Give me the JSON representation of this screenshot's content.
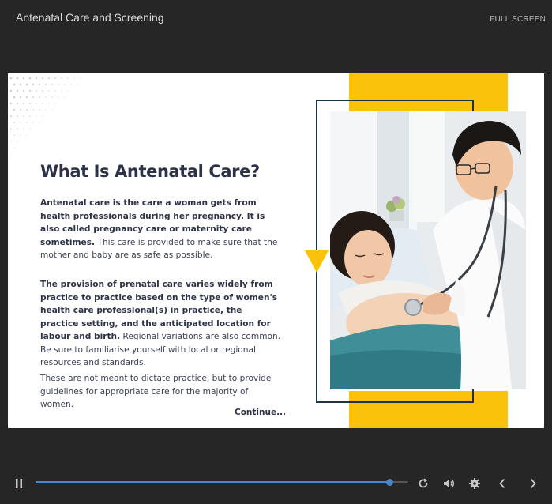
{
  "window": {
    "title": "Antenatal Care and Screening",
    "fullscreen_label": "FULL SCREEN"
  },
  "slide": {
    "heading": "What Is Antenatal Care?",
    "paragraphs": [
      {
        "bold": "Antenatal care is the care a woman gets from health professionals during her pregnancy. It is also called pregnancy care or maternity care sometimes.",
        "normal": " This care is provided to make sure that the mother and baby are as safe as possible."
      },
      {
        "bold": "The provision of prenatal care varies widely from practice to practice based on the type of women's health care professional(s) in practice, the practice setting, and the anticipated location for labour and birth.",
        "normal": " Regional variations are also common. Be sure to familiarise yourself with local or regional resources and standards."
      },
      {
        "bold": "",
        "normal": "These are not meant to dictate practice, but to provide guidelines for appropriate care for the majority of women."
      }
    ],
    "continue_label": "Continue...",
    "image_subject": "doctor-listening-to-pregnant-patient-with-stethoscope"
  },
  "player": {
    "progress": 0.95,
    "icons": {
      "pause": "pause-icon",
      "replay": "replay-icon",
      "volume": "volume-icon",
      "settings": "gear-icon",
      "previous": "chevron-left-icon",
      "next": "chevron-right-icon"
    }
  },
  "colors": {
    "background": "#262626",
    "accent_yellow": "#fbc20b",
    "frame_navy": "#1c3340",
    "progress_blue": "#4d86c8",
    "heading_text": "#2c3347"
  }
}
